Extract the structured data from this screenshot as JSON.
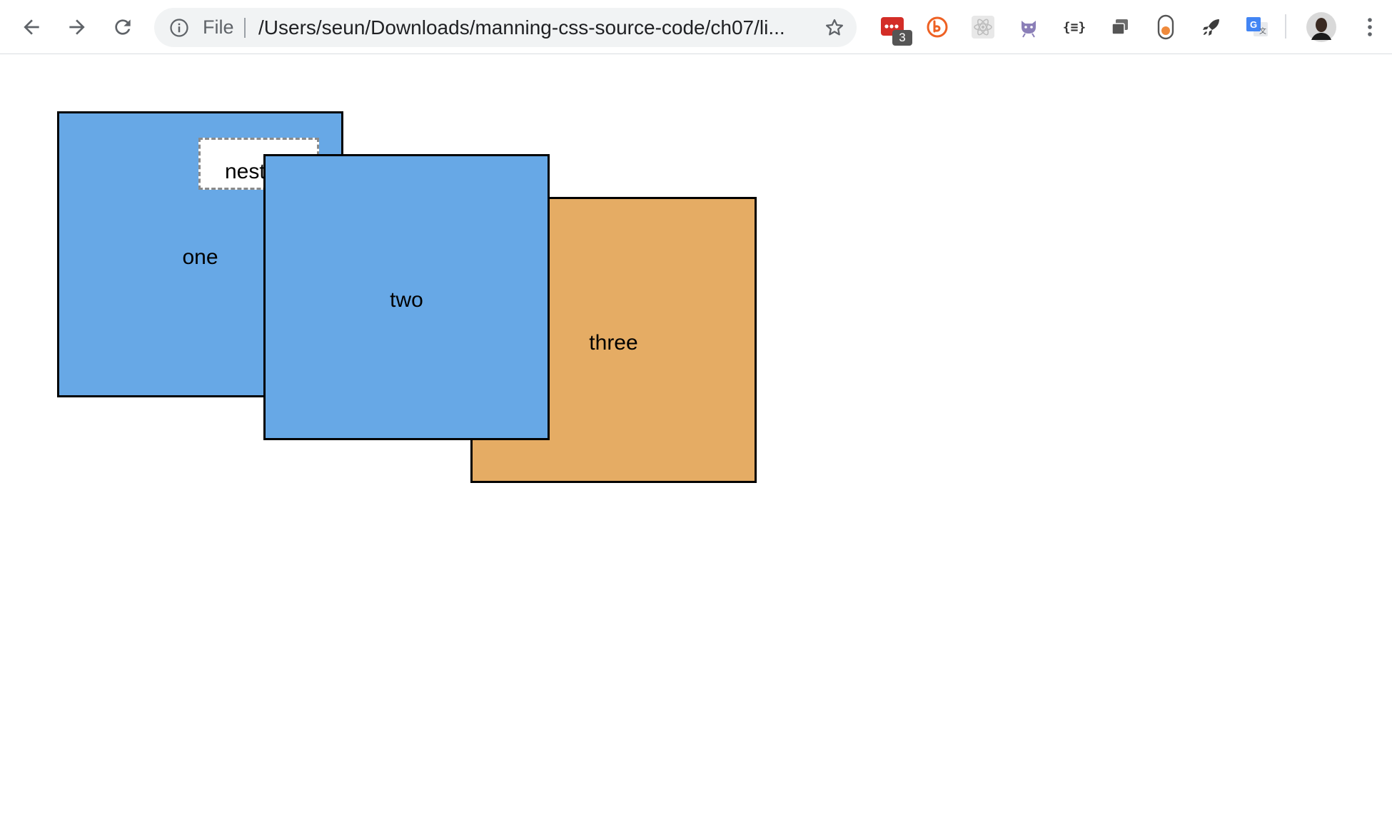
{
  "browser": {
    "omnibox": {
      "scheme_label": "File",
      "url": "/Users/seun/Downloads/manning-css-source-code/ch07/li..."
    },
    "extensions": {
      "lastpass_badge": "3",
      "json_viewer_label": "{≡}"
    }
  },
  "page": {
    "boxes": [
      {
        "label": "one",
        "color": "#67a8e6"
      },
      {
        "label": "two",
        "color": "#67a8e6"
      },
      {
        "label": "three",
        "color": "#e5ac64"
      }
    ],
    "nested": {
      "label": "nested"
    }
  },
  "colors": {
    "blue_box": "#67a8e6",
    "orange_box": "#e5ac64",
    "border": "#000000",
    "nested_border": "#8a8a8a"
  }
}
